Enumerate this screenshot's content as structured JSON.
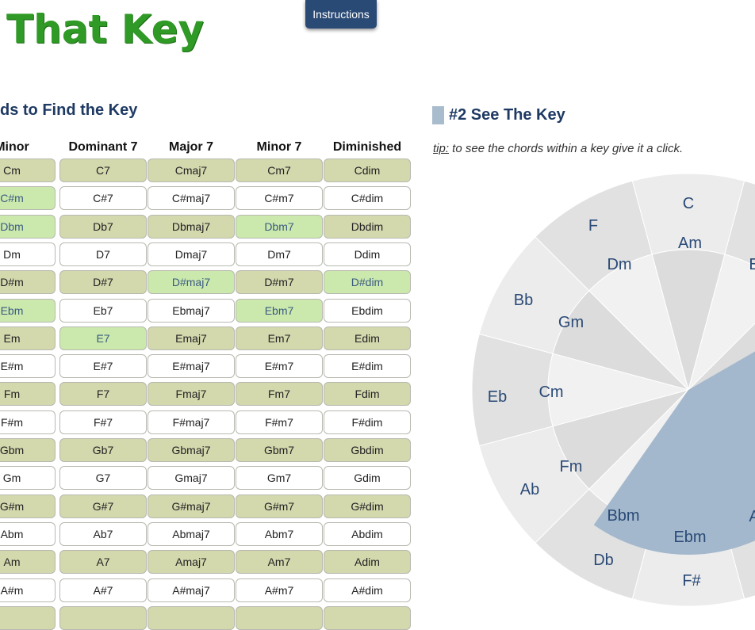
{
  "header": {
    "title": "That Key",
    "instructions_label": "Instructions"
  },
  "left_section": {
    "heading": "ds to Find the Key",
    "columns": [
      "Minor",
      "Dominant 7",
      "Major 7",
      "Minor 7",
      "Diminished"
    ],
    "rows": [
      [
        {
          "t": "Cm",
          "s": "olive"
        },
        {
          "t": "C7",
          "s": "olive"
        },
        {
          "t": "Cmaj7",
          "s": "olive"
        },
        {
          "t": "Cm7",
          "s": "olive"
        },
        {
          "t": "Cdim",
          "s": "olive"
        }
      ],
      [
        {
          "t": "C#m",
          "s": "green"
        },
        {
          "t": "C#7",
          "s": "white"
        },
        {
          "t": "C#maj7",
          "s": "white"
        },
        {
          "t": "C#m7",
          "s": "white"
        },
        {
          "t": "C#dim",
          "s": "white"
        }
      ],
      [
        {
          "t": "Dbm",
          "s": "green"
        },
        {
          "t": "Db7",
          "s": "olive"
        },
        {
          "t": "Dbmaj7",
          "s": "olive"
        },
        {
          "t": "Dbm7",
          "s": "green"
        },
        {
          "t": "Dbdim",
          "s": "olive"
        }
      ],
      [
        {
          "t": "Dm",
          "s": "white"
        },
        {
          "t": "D7",
          "s": "white"
        },
        {
          "t": "Dmaj7",
          "s": "white"
        },
        {
          "t": "Dm7",
          "s": "white"
        },
        {
          "t": "Ddim",
          "s": "white"
        }
      ],
      [
        {
          "t": "D#m",
          "s": "olive"
        },
        {
          "t": "D#7",
          "s": "olive"
        },
        {
          "t": "D#maj7",
          "s": "green"
        },
        {
          "t": "D#m7",
          "s": "olive"
        },
        {
          "t": "D#dim",
          "s": "green"
        }
      ],
      [
        {
          "t": "Ebm",
          "s": "green"
        },
        {
          "t": "Eb7",
          "s": "white"
        },
        {
          "t": "Ebmaj7",
          "s": "white"
        },
        {
          "t": "Ebm7",
          "s": "green"
        },
        {
          "t": "Ebdim",
          "s": "white"
        }
      ],
      [
        {
          "t": "Em",
          "s": "olive"
        },
        {
          "t": "E7",
          "s": "green"
        },
        {
          "t": "Emaj7",
          "s": "olive"
        },
        {
          "t": "Em7",
          "s": "olive"
        },
        {
          "t": "Edim",
          "s": "olive"
        }
      ],
      [
        {
          "t": "E#m",
          "s": "white"
        },
        {
          "t": "E#7",
          "s": "white"
        },
        {
          "t": "E#maj7",
          "s": "white"
        },
        {
          "t": "E#m7",
          "s": "white"
        },
        {
          "t": "E#dim",
          "s": "white"
        }
      ],
      [
        {
          "t": "Fm",
          "s": "olive"
        },
        {
          "t": "F7",
          "s": "olive"
        },
        {
          "t": "Fmaj7",
          "s": "olive"
        },
        {
          "t": "Fm7",
          "s": "olive"
        },
        {
          "t": "Fdim",
          "s": "olive"
        }
      ],
      [
        {
          "t": "F#m",
          "s": "white"
        },
        {
          "t": "F#7",
          "s": "white"
        },
        {
          "t": "F#maj7",
          "s": "white"
        },
        {
          "t": "F#m7",
          "s": "white"
        },
        {
          "t": "F#dim",
          "s": "white"
        }
      ],
      [
        {
          "t": "Gbm",
          "s": "olive"
        },
        {
          "t": "Gb7",
          "s": "olive"
        },
        {
          "t": "Gbmaj7",
          "s": "olive"
        },
        {
          "t": "Gbm7",
          "s": "olive"
        },
        {
          "t": "Gbdim",
          "s": "olive"
        }
      ],
      [
        {
          "t": "Gm",
          "s": "white"
        },
        {
          "t": "G7",
          "s": "white"
        },
        {
          "t": "Gmaj7",
          "s": "white"
        },
        {
          "t": "Gm7",
          "s": "white"
        },
        {
          "t": "Gdim",
          "s": "white"
        }
      ],
      [
        {
          "t": "G#m",
          "s": "olive"
        },
        {
          "t": "G#7",
          "s": "olive"
        },
        {
          "t": "G#maj7",
          "s": "olive"
        },
        {
          "t": "G#m7",
          "s": "olive"
        },
        {
          "t": "G#dim",
          "s": "olive"
        }
      ],
      [
        {
          "t": "Abm",
          "s": "white"
        },
        {
          "t": "Ab7",
          "s": "white"
        },
        {
          "t": "Abmaj7",
          "s": "white"
        },
        {
          "t": "Abm7",
          "s": "white"
        },
        {
          "t": "Abdim",
          "s": "white"
        }
      ],
      [
        {
          "t": "Am",
          "s": "olive"
        },
        {
          "t": "A7",
          "s": "olive"
        },
        {
          "t": "Amaj7",
          "s": "olive"
        },
        {
          "t": "Am7",
          "s": "olive"
        },
        {
          "t": "Adim",
          "s": "olive"
        }
      ],
      [
        {
          "t": "A#m",
          "s": "white"
        },
        {
          "t": "A#7",
          "s": "white"
        },
        {
          "t": "A#maj7",
          "s": "white"
        },
        {
          "t": "A#m7",
          "s": "white"
        },
        {
          "t": "A#dim",
          "s": "white"
        }
      ],
      [
        {
          "t": "",
          "s": "olive"
        },
        {
          "t": "",
          "s": "olive"
        },
        {
          "t": "",
          "s": "olive"
        },
        {
          "t": "",
          "s": "olive"
        },
        {
          "t": "",
          "s": "olive"
        }
      ]
    ]
  },
  "right_section": {
    "heading": "#2 See The Key",
    "tip_label": "tip:",
    "tip_text": " to see the chords within a key give it a click.",
    "wheel": {
      "outer_keys": [
        "C",
        "F",
        "Bb",
        "Eb",
        "Ab",
        "Db",
        "F#"
      ],
      "inner_keys": [
        "Am",
        "Dm",
        "Gm",
        "Cm",
        "Fm",
        "Bbm",
        "Ebm"
      ],
      "edge_labels": [
        "E",
        "A"
      ],
      "highlight_color": "#a3b8cc"
    }
  },
  "colors": {
    "title_green": "#2f9a25",
    "button_blue": "#2a4a76",
    "cell_olive": "#d3d8ad",
    "cell_green": "#cbe9ad",
    "heading_navy": "#1e3a63"
  }
}
